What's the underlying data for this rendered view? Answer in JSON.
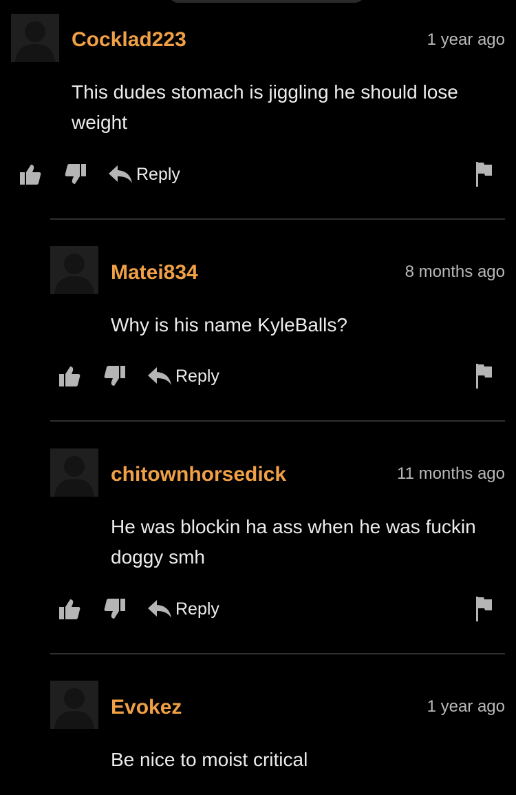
{
  "colors": {
    "background": "#000000",
    "username": "#f0a045",
    "text": "#ececec",
    "timestamp": "#b9b9b9",
    "icon": "#b5b5b5",
    "avatar_bg": "#1f1f1f",
    "divider": "#2f2f2f"
  },
  "comments": [
    {
      "username": "Cocklad223",
      "time": "1 year ago",
      "text": "This dudes stomach is jiggling he should lose weight",
      "reply_label": "Reply",
      "icons": [
        "thumbs-up-icon",
        "thumbs-down-icon",
        "reply-arrow-icon",
        "flag-icon"
      ]
    },
    {
      "username": "Matei834",
      "time": "8 months ago",
      "text": "Why is his name KyleBalls?",
      "reply_label": "Reply",
      "icons": [
        "thumbs-up-icon",
        "thumbs-down-icon",
        "reply-arrow-icon",
        "flag-icon"
      ]
    },
    {
      "username": "chitownhorsedick",
      "time": "11 months ago",
      "text": "He was blockin ha ass when he was fuckin doggy smh",
      "reply_label": "Reply",
      "icons": [
        "thumbs-up-icon",
        "thumbs-down-icon",
        "reply-arrow-icon",
        "flag-icon"
      ]
    },
    {
      "username": "Evokez",
      "time": "1 year ago",
      "text": "Be nice to moist critical",
      "icons": []
    }
  ]
}
